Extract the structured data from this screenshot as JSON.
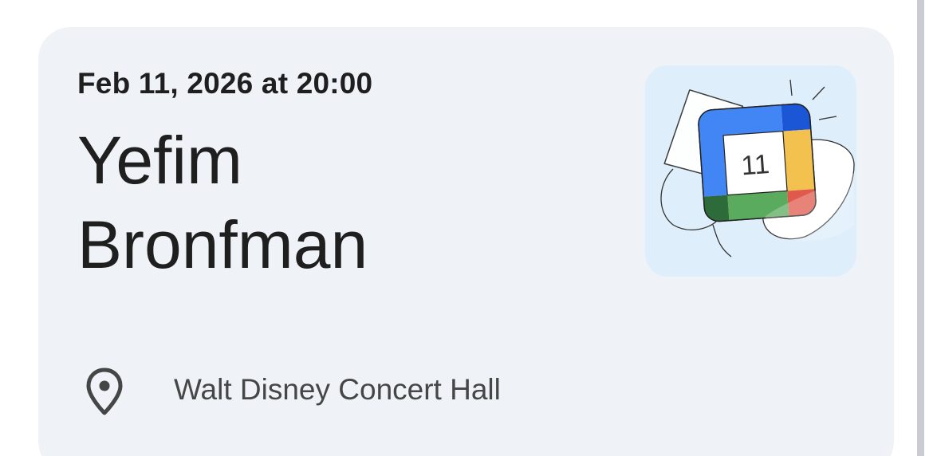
{
  "event": {
    "datetime": "Feb 11, 2026 at 20:00",
    "title_line1": "Yefim",
    "title_line2": "Bronfman",
    "location": "Walt Disney Concert Hall",
    "calendar_day": "11"
  },
  "icons": {
    "location": "location-pin-icon",
    "calendar": "google-calendar-icon"
  },
  "colors": {
    "card_background": "#eff3f8",
    "illustration_background": "#deeefa",
    "calendar_blue": "#4285f4",
    "calendar_dark_blue": "#1a56d6",
    "calendar_yellow": "#f2c14e",
    "calendar_green": "#5bab5e",
    "calendar_dark_green": "#2e6b3a",
    "calendar_red": "#df5a4c"
  }
}
